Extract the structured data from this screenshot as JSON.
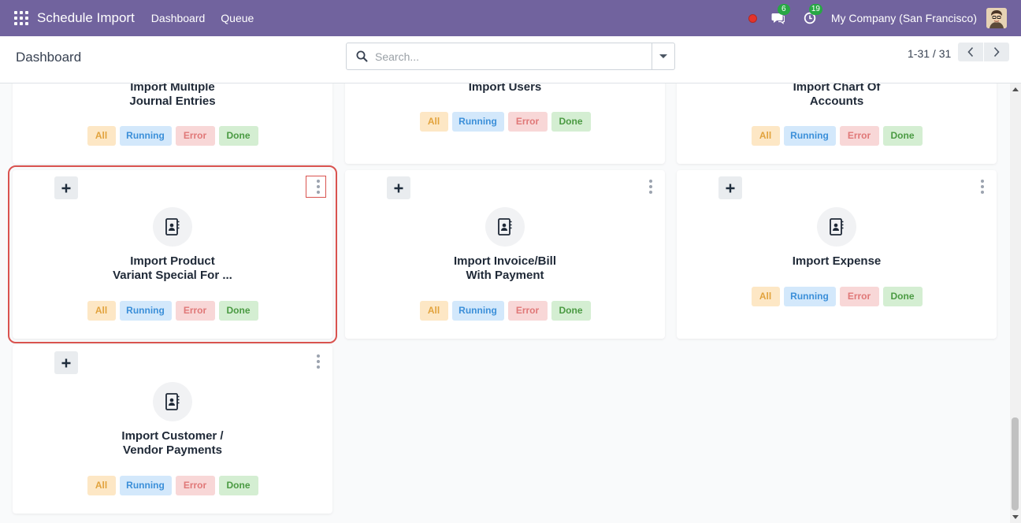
{
  "navbar": {
    "app_name": "Schedule Import",
    "menu": [
      "Dashboard",
      "Queue"
    ],
    "messages_count": "6",
    "activities_count": "19",
    "company": "My Company (San Francisco)"
  },
  "control_panel": {
    "title": "Dashboard",
    "search_placeholder": "Search...",
    "pager": "1-31 / 31"
  },
  "pill_labels": {
    "all": "All",
    "running": "Running",
    "error": "Error",
    "done": "Done"
  },
  "cards": [
    {
      "title_line1": "Import Multiple",
      "title_line2": "Journal Entries"
    },
    {
      "title_line1": "Import Users",
      "title_line2": ""
    },
    {
      "title_line1": "Import Chart Of",
      "title_line2": "Accounts"
    },
    {
      "title_line1": "Import Product",
      "title_line2": "Variant Special For ..."
    },
    {
      "title_line1": "Import Invoice/Bill",
      "title_line2": "With Payment"
    },
    {
      "title_line1": "Import Expense",
      "title_line2": ""
    },
    {
      "title_line1": "Import Customer /",
      "title_line2": "Vendor Payments"
    }
  ],
  "icons": {
    "apps": "apps-grid-icon",
    "messages": "chat-icon",
    "activities": "clock-icon",
    "search": "search-icon",
    "card": "contact-book-icon",
    "add": "plus-icon",
    "menu": "vertical-dots-icon"
  },
  "colors": {
    "navbar": "#71639e",
    "selection_outline": "#d9534f",
    "all": "#e2a33d",
    "running": "#3b8fd9",
    "error": "#e07878",
    "done": "#4a9a42"
  }
}
